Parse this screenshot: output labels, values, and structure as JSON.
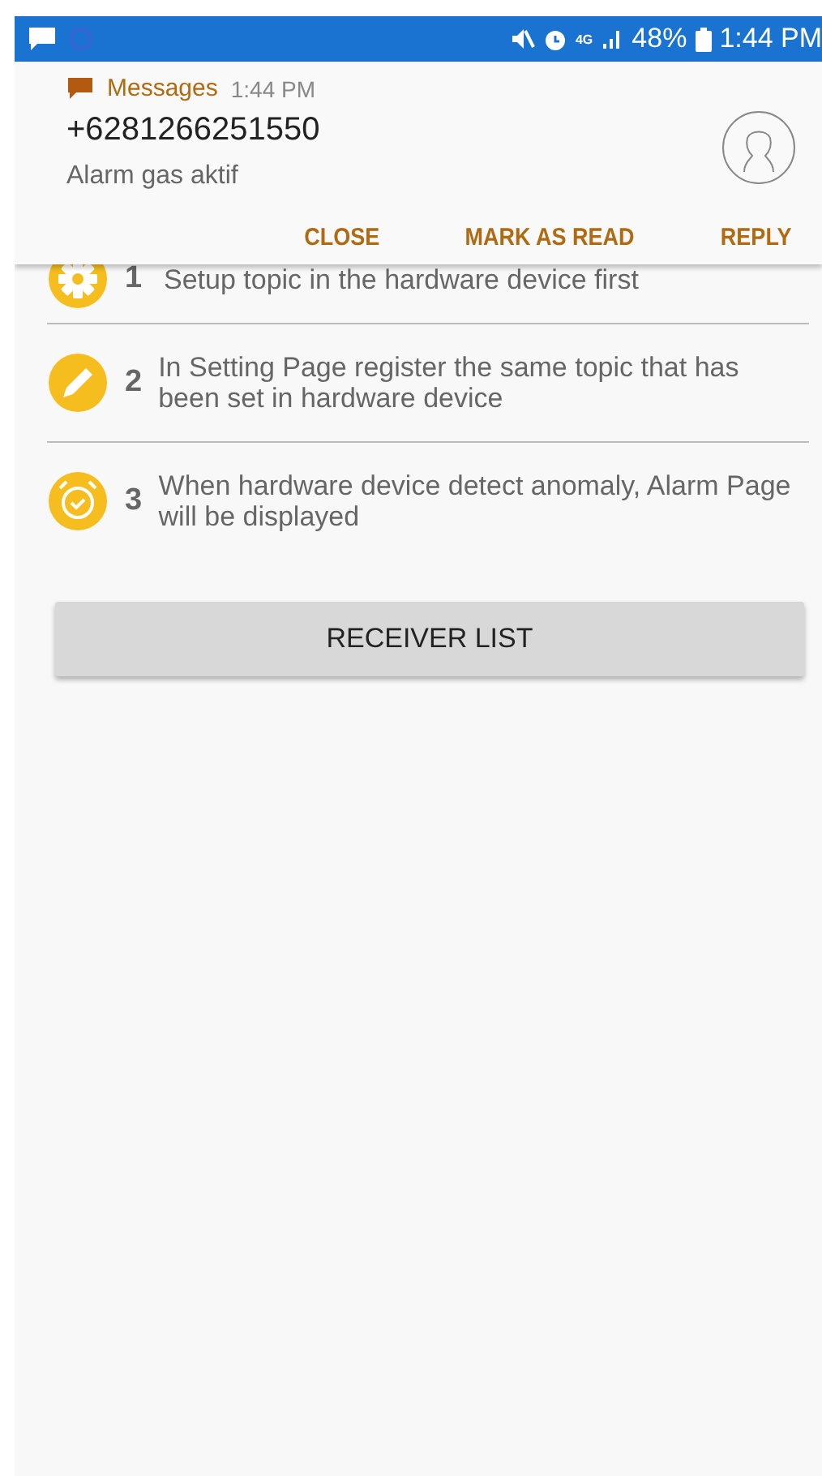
{
  "status_bar": {
    "network": "4G",
    "battery": "48%",
    "time": "1:44 PM"
  },
  "notification": {
    "app": "Messages",
    "time": "1:44 PM",
    "sender": "+6281266251550",
    "body": "Alarm gas aktif",
    "actions": [
      "CLOSE",
      "MARK AS READ",
      "REPLY"
    ]
  },
  "steps": [
    {
      "kind": "gear",
      "number": "1",
      "text": "Setup topic in the hardware device first"
    },
    {
      "kind": "pencil",
      "number": "2",
      "text": "In Setting Page register the same topic that has been set in hardware device"
    },
    {
      "kind": "alarm",
      "number": "3",
      "text": "When hardware device detect anomaly, Alarm Page will be displayed"
    }
  ],
  "button": "RECEIVER LIST"
}
